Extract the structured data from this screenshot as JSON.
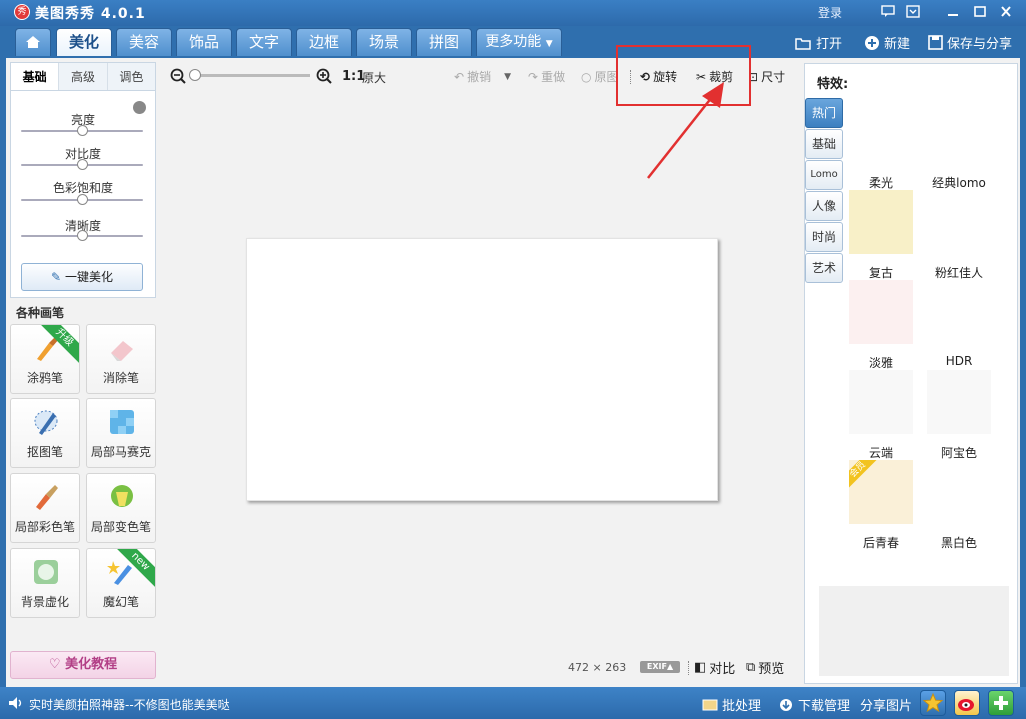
{
  "window": {
    "app_logo": "秀",
    "title": "美图秀秀 4.0.1",
    "login": "登录",
    "controls": [
      "chat-icon",
      "menu-icon",
      "minimize-icon",
      "maximize-icon",
      "close-icon"
    ]
  },
  "tabs": [
    {
      "icon": "home-icon",
      "label": ""
    },
    {
      "label": "美化",
      "active": true
    },
    {
      "label": "美容"
    },
    {
      "label": "饰品"
    },
    {
      "label": "文字"
    },
    {
      "label": "边框"
    },
    {
      "label": "场景"
    },
    {
      "label": "拼图"
    },
    {
      "label": "更多功能"
    }
  ],
  "top_actions": {
    "open": "打开",
    "new": "新建",
    "save_share": "保存与分享"
  },
  "adjust": {
    "subtabs": [
      "基础",
      "高级",
      "调色"
    ],
    "sliders": [
      {
        "label": "亮度",
        "value": 0.5
      },
      {
        "label": "对比度",
        "value": 0.5
      },
      {
        "label": "色彩饱和度",
        "value": 0.5
      },
      {
        "label": "清晰度",
        "value": 0.5
      }
    ],
    "one_click": "一键美化"
  },
  "pens": {
    "title": "各种画笔",
    "items": [
      {
        "label": "涂鸦笔",
        "badge": "升级",
        "icon": "brush-icon"
      },
      {
        "label": "消除笔",
        "badge": "",
        "icon": "eraser-icon"
      },
      {
        "label": "抠图笔",
        "badge": "",
        "icon": "cutout-pen-icon"
      },
      {
        "label": "局部马赛克",
        "badge": "",
        "icon": "mosaic-icon"
      },
      {
        "label": "局部彩色笔",
        "badge": "",
        "icon": "color-brush-icon"
      },
      {
        "label": "局部变色笔",
        "badge": "",
        "icon": "recolor-icon"
      },
      {
        "label": "背景虚化",
        "badge": "",
        "icon": "blur-icon"
      },
      {
        "label": "魔幻笔",
        "badge": "new",
        "icon": "magic-pen-icon"
      }
    ],
    "tutorial": "美化教程"
  },
  "toolbar": {
    "ratio": "1:1",
    "original_size": "原大",
    "undo": "撤销",
    "redo": "重做",
    "reset": "原图",
    "rotate": "旋转",
    "crop": "裁剪",
    "resize": "尺寸",
    "zoom_level": 0.05
  },
  "canvas": {
    "width": 472,
    "height": 263,
    "size_text": "472 × 263",
    "exif": "EXIF▲",
    "compare": "对比",
    "preview": "预览"
  },
  "effects": {
    "title": "特效:",
    "categories": [
      "热门",
      "基础",
      "Lomo",
      "人像",
      "时尚",
      "艺术"
    ],
    "active_category": "热门",
    "items": [
      {
        "label": "柔光",
        "color": "#ffffff"
      },
      {
        "label": "经典lomo",
        "color": "#ffffff"
      },
      {
        "label": "复古",
        "color": "#f8f0c8"
      },
      {
        "label": "粉红佳人",
        "color": "#ffffff"
      },
      {
        "label": "淡雅",
        "color": "#fcf0f0"
      },
      {
        "label": "HDR",
        "color": "#ffffff"
      },
      {
        "label": "云端",
        "color": "#f8f8f8"
      },
      {
        "label": "阿宝色",
        "color": "#f8f8f8"
      },
      {
        "label": "后青春",
        "color": "#faf0d8",
        "badge": "会员"
      },
      {
        "label": "黑白色",
        "color": "#ffffff"
      }
    ]
  },
  "status": {
    "message": "实时美颜拍照神器--不修图也能美美哒",
    "batch": "批处理",
    "download": "下载管理",
    "share": "分享图片",
    "icons": [
      "star-icon",
      "weibo-icon",
      "plus-icon"
    ]
  },
  "colors": {
    "frame": "#2f6fae",
    "highlight": "#e23030",
    "ribbon_green": "#2fa84a"
  }
}
